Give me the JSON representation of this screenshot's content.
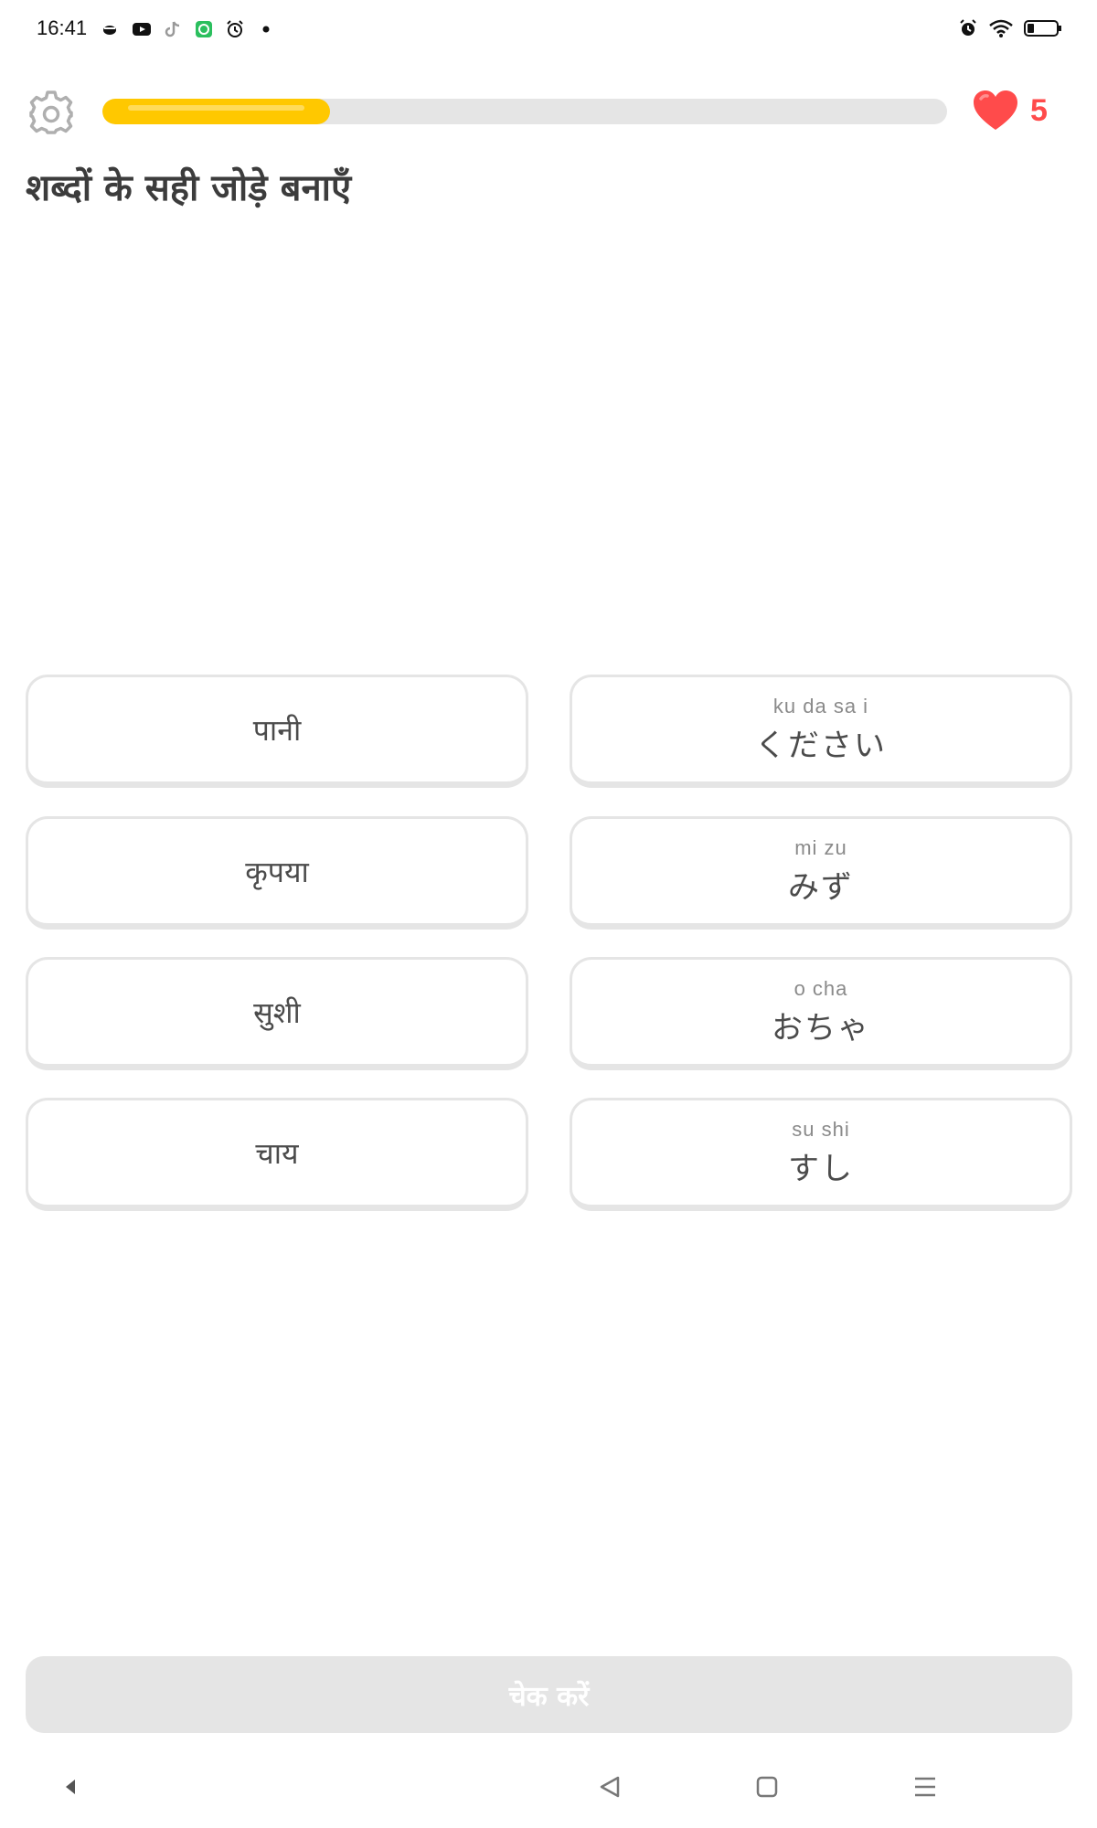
{
  "status_bar": {
    "time": "16:41",
    "left_icons": [
      "coffee-cup-icon",
      "youtube-icon",
      "tiktok-icon",
      "green-app-icon",
      "alarm-icon",
      "dot-icon"
    ],
    "right_icons": [
      "alarm-icon",
      "wifi-icon",
      "battery-icon"
    ]
  },
  "header": {
    "progress_fraction": 0.27,
    "hearts": "5",
    "colors": {
      "progress": "#ffc800",
      "track": "#e5e5e5",
      "heart": "#ff4b4b"
    }
  },
  "prompt": {
    "title": "शब्दों के सही जोड़े बनाएँ"
  },
  "left_tiles": [
    {
      "text": "पानी"
    },
    {
      "text": "कृपया"
    },
    {
      "text": "सुशी"
    },
    {
      "text": "चाय"
    }
  ],
  "right_tiles": [
    {
      "reading": "ku da sa  i",
      "text": "ください"
    },
    {
      "reading": "mi zu",
      "text": "みず"
    },
    {
      "reading": "o   cha",
      "text": "おちゃ"
    },
    {
      "reading": "su shi",
      "text": "すし"
    }
  ],
  "footer": {
    "check_label": "चेक करें"
  },
  "nav": {
    "buttons": [
      "back-small-icon",
      "back-icon",
      "home-icon",
      "menu-icon"
    ]
  }
}
